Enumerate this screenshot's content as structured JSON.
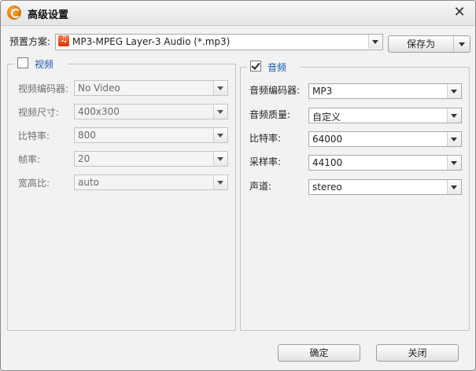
{
  "window": {
    "title": "高级设置",
    "close_glyph": "✕"
  },
  "preset": {
    "label": "预置方案:",
    "value": "MP3-MPEG Layer-3 Audio (*.mp3)",
    "icon": "mp3-file-icon"
  },
  "save_as": {
    "label": "保存为"
  },
  "video": {
    "title": "视频",
    "enabled": false,
    "rows": [
      {
        "label": "视频编码器:",
        "value": "No Video"
      },
      {
        "label": "视频尺寸:",
        "value": "400x300"
      },
      {
        "label": "比特率:",
        "value": "800"
      },
      {
        "label": "帧率:",
        "value": "20"
      },
      {
        "label": "宽高比:",
        "value": "auto"
      }
    ]
  },
  "audio": {
    "title": "音频",
    "enabled": true,
    "rows": [
      {
        "label": "音频编码器:",
        "value": "MP3"
      },
      {
        "label": "音频质量:",
        "value": "自定义"
      },
      {
        "label": "比特率:",
        "value": "64000"
      },
      {
        "label": "采样率:",
        "value": "44100"
      },
      {
        "label": "声道:",
        "value": "stereo"
      }
    ]
  },
  "buttons": {
    "ok": "确定",
    "close": "关闭"
  },
  "colors": {
    "group_title": "#1a55b5",
    "window_bg": "#f2f2f2"
  }
}
